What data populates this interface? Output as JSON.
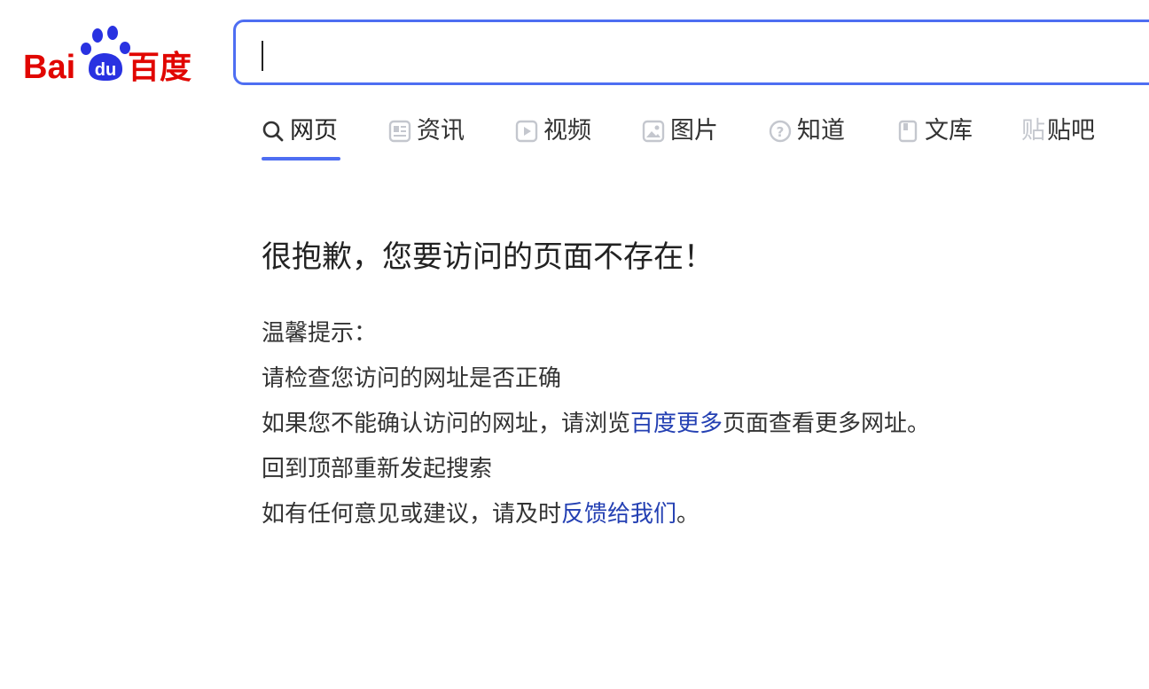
{
  "logo": {
    "text_bai": "Bai",
    "text_du": "du",
    "text_cn": "百度",
    "colors": {
      "red": "#e10601",
      "blue": "#2932e1"
    }
  },
  "search": {
    "value": "",
    "placeholder": "",
    "border_color": "#4e6ef2"
  },
  "tabs": [
    {
      "label": "网页",
      "icon": "search-icon",
      "active": true
    },
    {
      "label": "资讯",
      "icon": "news-icon",
      "active": false
    },
    {
      "label": "视频",
      "icon": "video-icon",
      "active": false
    },
    {
      "label": "图片",
      "icon": "image-icon",
      "active": false
    },
    {
      "label": "知道",
      "icon": "question-icon",
      "active": false
    },
    {
      "label": "文库",
      "icon": "document-icon",
      "active": false
    },
    {
      "label": "贴吧",
      "icon": "tieba-icon",
      "icon_glyph": "贴",
      "active": false
    }
  ],
  "error": {
    "title": "很抱歉，您要访问的页面不存在！",
    "tips_heading": "温馨提示：",
    "tip1": "请检查您访问的网址是否正确",
    "tip2_pre": "如果您不能确认访问的网址，请浏览",
    "tip2_link": "百度更多",
    "tip2_post": "页面查看更多网址。",
    "tip3": "回到顶部重新发起搜索",
    "tip4_pre": "如有任何意见或建议，请及时",
    "tip4_link": "反馈给我们",
    "tip4_post": "。"
  },
  "colors": {
    "accent": "#4e6ef2",
    "link": "#2440b3",
    "icon_gray": "#c4c7ce"
  }
}
